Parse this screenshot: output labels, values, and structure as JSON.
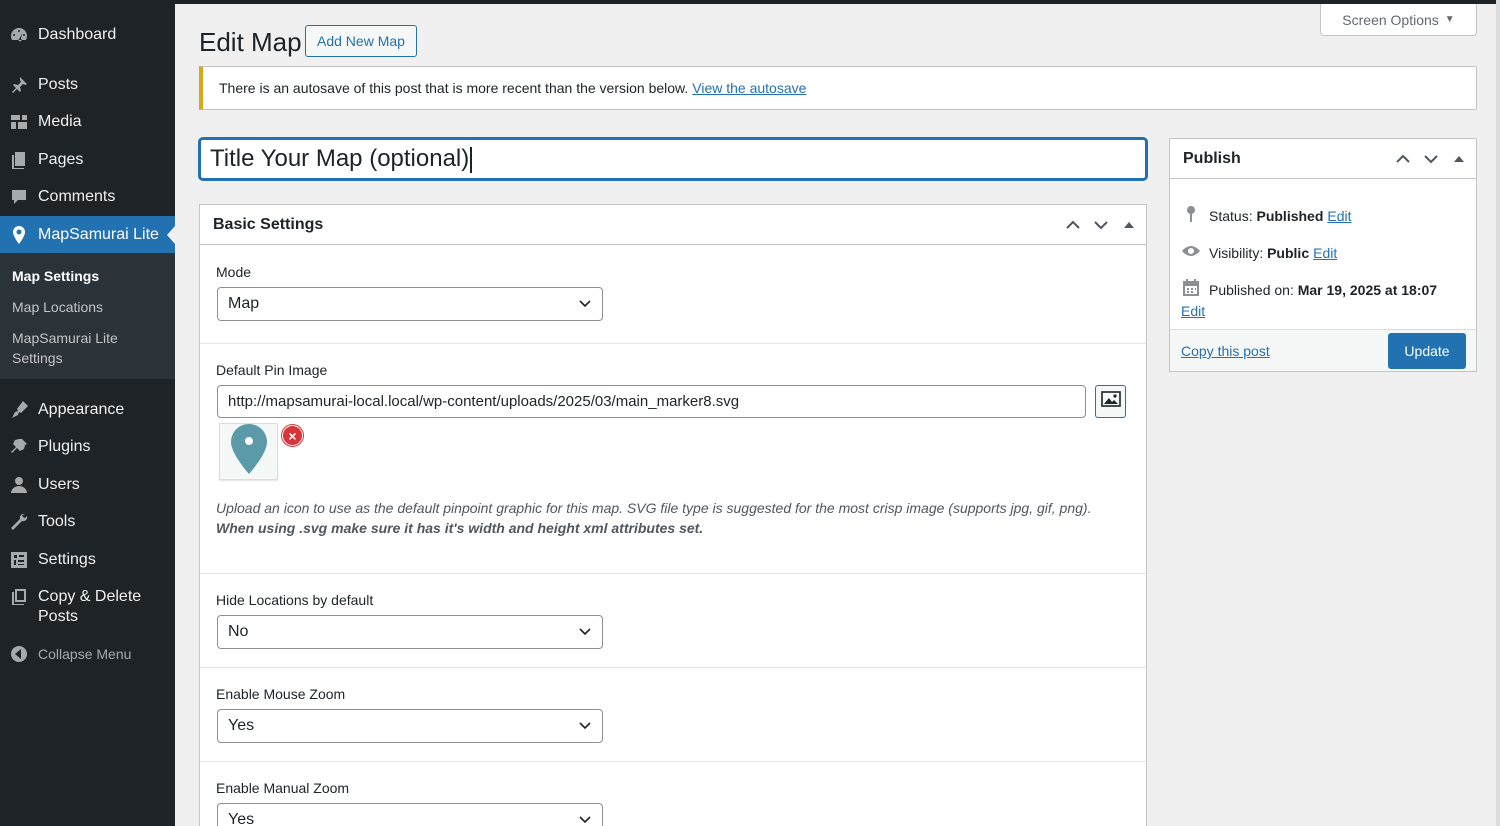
{
  "sidebar": {
    "items": [
      {
        "label": "Dashboard",
        "icon": "dashboard-icon"
      },
      {
        "label": "Posts",
        "icon": "pin-icon"
      },
      {
        "label": "Media",
        "icon": "media-icon"
      },
      {
        "label": "Pages",
        "icon": "pages-icon"
      },
      {
        "label": "Comments",
        "icon": "comments-icon"
      },
      {
        "label": "MapSamurai Lite",
        "icon": "location-icon"
      },
      {
        "label": "Appearance",
        "icon": "appearance-icon"
      },
      {
        "label": "Plugins",
        "icon": "plugins-icon"
      },
      {
        "label": "Users",
        "icon": "users-icon"
      },
      {
        "label": "Tools",
        "icon": "tools-icon"
      },
      {
        "label": "Settings",
        "icon": "settings-icon"
      },
      {
        "label": "Copy & Delete Posts",
        "icon": "copy-icon"
      }
    ],
    "submenu": [
      "Map Settings",
      "Map Locations",
      "MapSamurai Lite Settings"
    ],
    "collapse_label": "Collapse Menu",
    "accent": "#2271b1"
  },
  "header": {
    "title": "Edit Map",
    "add_new_label": "Add New Map",
    "screen_options_label": "Screen Options"
  },
  "notice": {
    "text": "There is an autosave of this post that is more recent than the version below.",
    "link": "View the autosave"
  },
  "title_field": {
    "value": "Title Your Map (optional)"
  },
  "basic_settings": {
    "title": "Basic Settings",
    "mode": {
      "label": "Mode",
      "value": "Map"
    },
    "pin": {
      "label": "Default Pin Image",
      "value": "http://mapsamurai-local.local/wp-content/uploads/2025/03/main_marker8.svg",
      "desc": "Upload an icon to use as the default pinpoint graphic for this map. SVG file type is suggested for the most crisp image (supports jpg, gif, png).",
      "desc_bold": "When using .svg make sure it has it's width and height xml attributes set."
    },
    "hide_locations": {
      "label": "Hide Locations by default",
      "value": "No"
    },
    "mouse_zoom": {
      "label": "Enable Mouse Zoom",
      "value": "Yes"
    },
    "manual_zoom": {
      "label": "Enable Manual Zoom",
      "value": "Yes"
    }
  },
  "publish": {
    "title": "Publish",
    "status_label": "Status:",
    "status_value": "Published",
    "visibility_label": "Visibility:",
    "visibility_value": "Public",
    "published_label": "Published on:",
    "published_value": "Mar 19, 2025 at 18:07",
    "edit_label": "Edit",
    "copy_label": "Copy this post",
    "update_label": "Update"
  }
}
